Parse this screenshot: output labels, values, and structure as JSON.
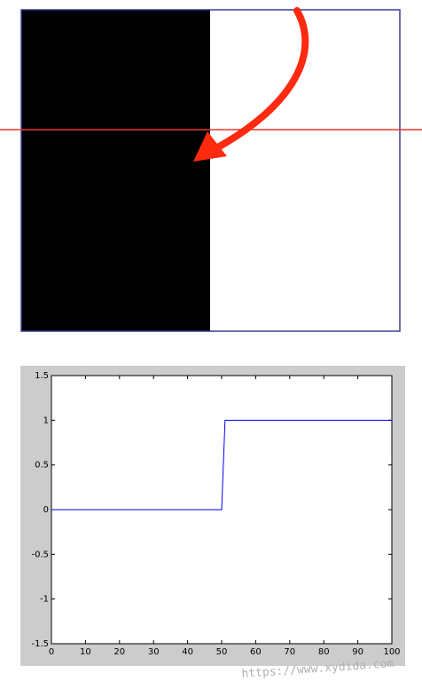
{
  "image_panel": {
    "frame_color": "#3b3b8f",
    "left_region_color": "#000000",
    "right_region_color": "#ffffff",
    "scan_line_color": "#e53a2a",
    "arrow_color": "#ff2a10"
  },
  "chart_data": {
    "type": "line",
    "title": "",
    "xlabel": "",
    "ylabel": "",
    "xlim": [
      0,
      100
    ],
    "ylim": [
      -1.5,
      1.5
    ],
    "x_ticks": [
      0,
      10,
      20,
      30,
      40,
      50,
      60,
      70,
      80,
      90,
      100
    ],
    "y_ticks": [
      1.5,
      1,
      0.5,
      0,
      -0.5,
      -1,
      -1.5
    ],
    "x_tick_labels": [
      "0",
      "10",
      "20",
      "30",
      "40",
      "50",
      "60",
      "70",
      "80",
      "90",
      "100"
    ],
    "y_tick_labels": [
      "1.5",
      "1",
      "0.5",
      "0",
      "-0.5",
      "-1",
      "-1.5"
    ],
    "grid": false,
    "background": "#cccccc",
    "series": [
      {
        "color": "#0000ff",
        "x": [
          0,
          50,
          51,
          100
        ],
        "y": [
          0,
          0,
          1,
          1
        ]
      }
    ]
  },
  "watermark": "https://www.xydida.com"
}
